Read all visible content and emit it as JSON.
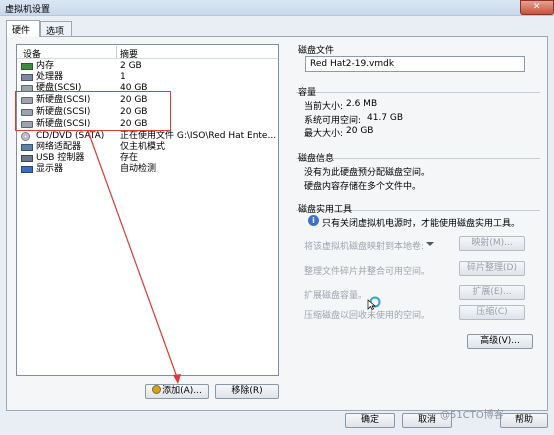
{
  "window": {
    "title": "虚拟机设置"
  },
  "tabs": [
    {
      "label": "硬件"
    },
    {
      "label": "选项"
    }
  ],
  "device_list": {
    "col_device": "设备",
    "col_summary": "摘要",
    "rows": [
      {
        "name": "内存",
        "summary": "2 GB",
        "icon": "memory-icon"
      },
      {
        "name": "处理器",
        "summary": "1",
        "icon": "cpu-icon"
      },
      {
        "name": "硬盘(SCSI)",
        "summary": "40 GB",
        "icon": "harddisk-icon"
      },
      {
        "name": "新硬盘(SCSI)",
        "summary": "20 GB",
        "icon": "harddisk-icon"
      },
      {
        "name": "新硬盘(SCSI)",
        "summary": "20 GB",
        "icon": "harddisk-icon"
      },
      {
        "name": "新硬盘(SCSI)",
        "summary": "20 GB",
        "icon": "harddisk-icon"
      },
      {
        "name": "CD/DVD (SATA)",
        "summary": "正在使用文件 G:\\ISO\\Red Hat Ente...",
        "icon": "cd-dvd-icon"
      },
      {
        "name": "网络适配器",
        "summary": "仅主机模式",
        "icon": "network-adapter-icon"
      },
      {
        "name": "USB 控制器",
        "summary": "存在",
        "icon": "usb-controller-icon"
      },
      {
        "name": "显示器",
        "summary": "自动检测",
        "icon": "display-icon"
      }
    ]
  },
  "buttons": {
    "add": "添加(A)...",
    "remove": "移除(R)",
    "ok": "确定",
    "cancel": "取消",
    "help": "帮助"
  },
  "disk_file": {
    "title": "磁盘文件",
    "value": "Red Hat2-19.vmdk"
  },
  "capacity": {
    "title": "容量",
    "current_size_label": "当前大小:",
    "current_size_value": "2.6 MB",
    "free_space_label": "系统可用空间:",
    "free_space_value": "41.7 GB",
    "max_size_label": "最大大小:",
    "max_size_value": "20 GB"
  },
  "disk_info": {
    "title": "磁盘信息",
    "line1": "没有为此硬盘预分配磁盘空间。",
    "line2": "硬盘内容存储在多个文件中。"
  },
  "disk_utilities": {
    "title": "磁盘实用工具",
    "notice": "只有关闭虚拟机电源时，才能使用磁盘实用工具。",
    "map_label": "将该虚拟机磁盘映射到本地卷:",
    "map_button": "映射(M)...",
    "defrag_label": "整理文件碎片并整合可用空间。",
    "defrag_button": "碎片整理(D)",
    "expand_label": "扩展磁盘容量。",
    "expand_button": "扩展(E)...",
    "compact_label": "压缩磁盘以回收未使用的空间。",
    "compact_button": "压缩(C)"
  },
  "advanced_button": "高级(V)...",
  "watermark": "@51CTO博客",
  "colors": {
    "highlight_border": "#e0393b",
    "arrow": "#e0393b"
  }
}
